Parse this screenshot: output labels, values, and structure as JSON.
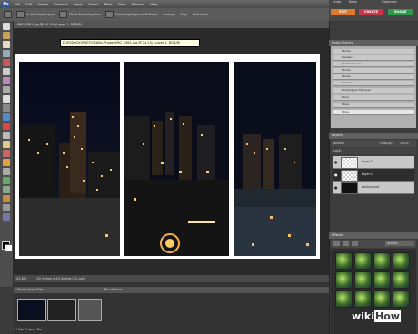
{
  "menubar": {
    "app_logo": "Ps",
    "items": [
      "File",
      "Edit",
      "Image",
      "Enhance",
      "Layer",
      "Select",
      "Filter",
      "View",
      "Window",
      "Help"
    ],
    "undo": "Undo",
    "redo": "Redo",
    "organizer": "Organizer"
  },
  "modes": {
    "edit": "EDIT",
    "create": "CREATE",
    "share": "SHARE",
    "full": "Full",
    "quick": "Quick",
    "guided": "Guided"
  },
  "options": [
    "Auto Select Layer",
    "Show Bounding Box",
    "Show Highlight on Rollover",
    "Arrange",
    "Align",
    "Distribute"
  ],
  "document": {
    "tab_title": "IMG_5361.jpg @ 24.1% (Layer 1, RGB/8)",
    "tooltip": "D:\\ESDOCK\\PHOTOS\\Wiki-Photos\\IMG_5361.jpg @ 24.1% (Layer 1, RGB/8)",
    "zoom": "24.8%",
    "status_text": "30 inches x 20 inches (72 ppi)"
  },
  "project_bin": {
    "header_left": "Show Open Files",
    "header_right": "Bin Actions",
    "footer": "1 Hide Project Bin"
  },
  "undo_history": {
    "title": "Undo History",
    "items": [
      "Stroke",
      "Deselect",
      "Select Canvas",
      "Stroke",
      "Stroke",
      "Deselect",
      "Rectangular Marquee",
      "Move",
      "Move",
      "Move"
    ]
  },
  "layers": {
    "title": "Layers",
    "blend_mode": "Normal",
    "opacity_label": "Opacity:",
    "opacity_value": "100%",
    "lock_label": "Lock:",
    "items": [
      {
        "name": "Layer 2"
      },
      {
        "name": "Layer 1"
      },
      {
        "name": "Background"
      }
    ]
  },
  "effects": {
    "title": "Effects",
    "filter_label": "Artistic"
  },
  "watermark": {
    "wiki": "wiki",
    "how": "How"
  },
  "colors": {
    "edit": "#e0782a",
    "create": "#c8364a",
    "share": "#2e9a4a"
  }
}
